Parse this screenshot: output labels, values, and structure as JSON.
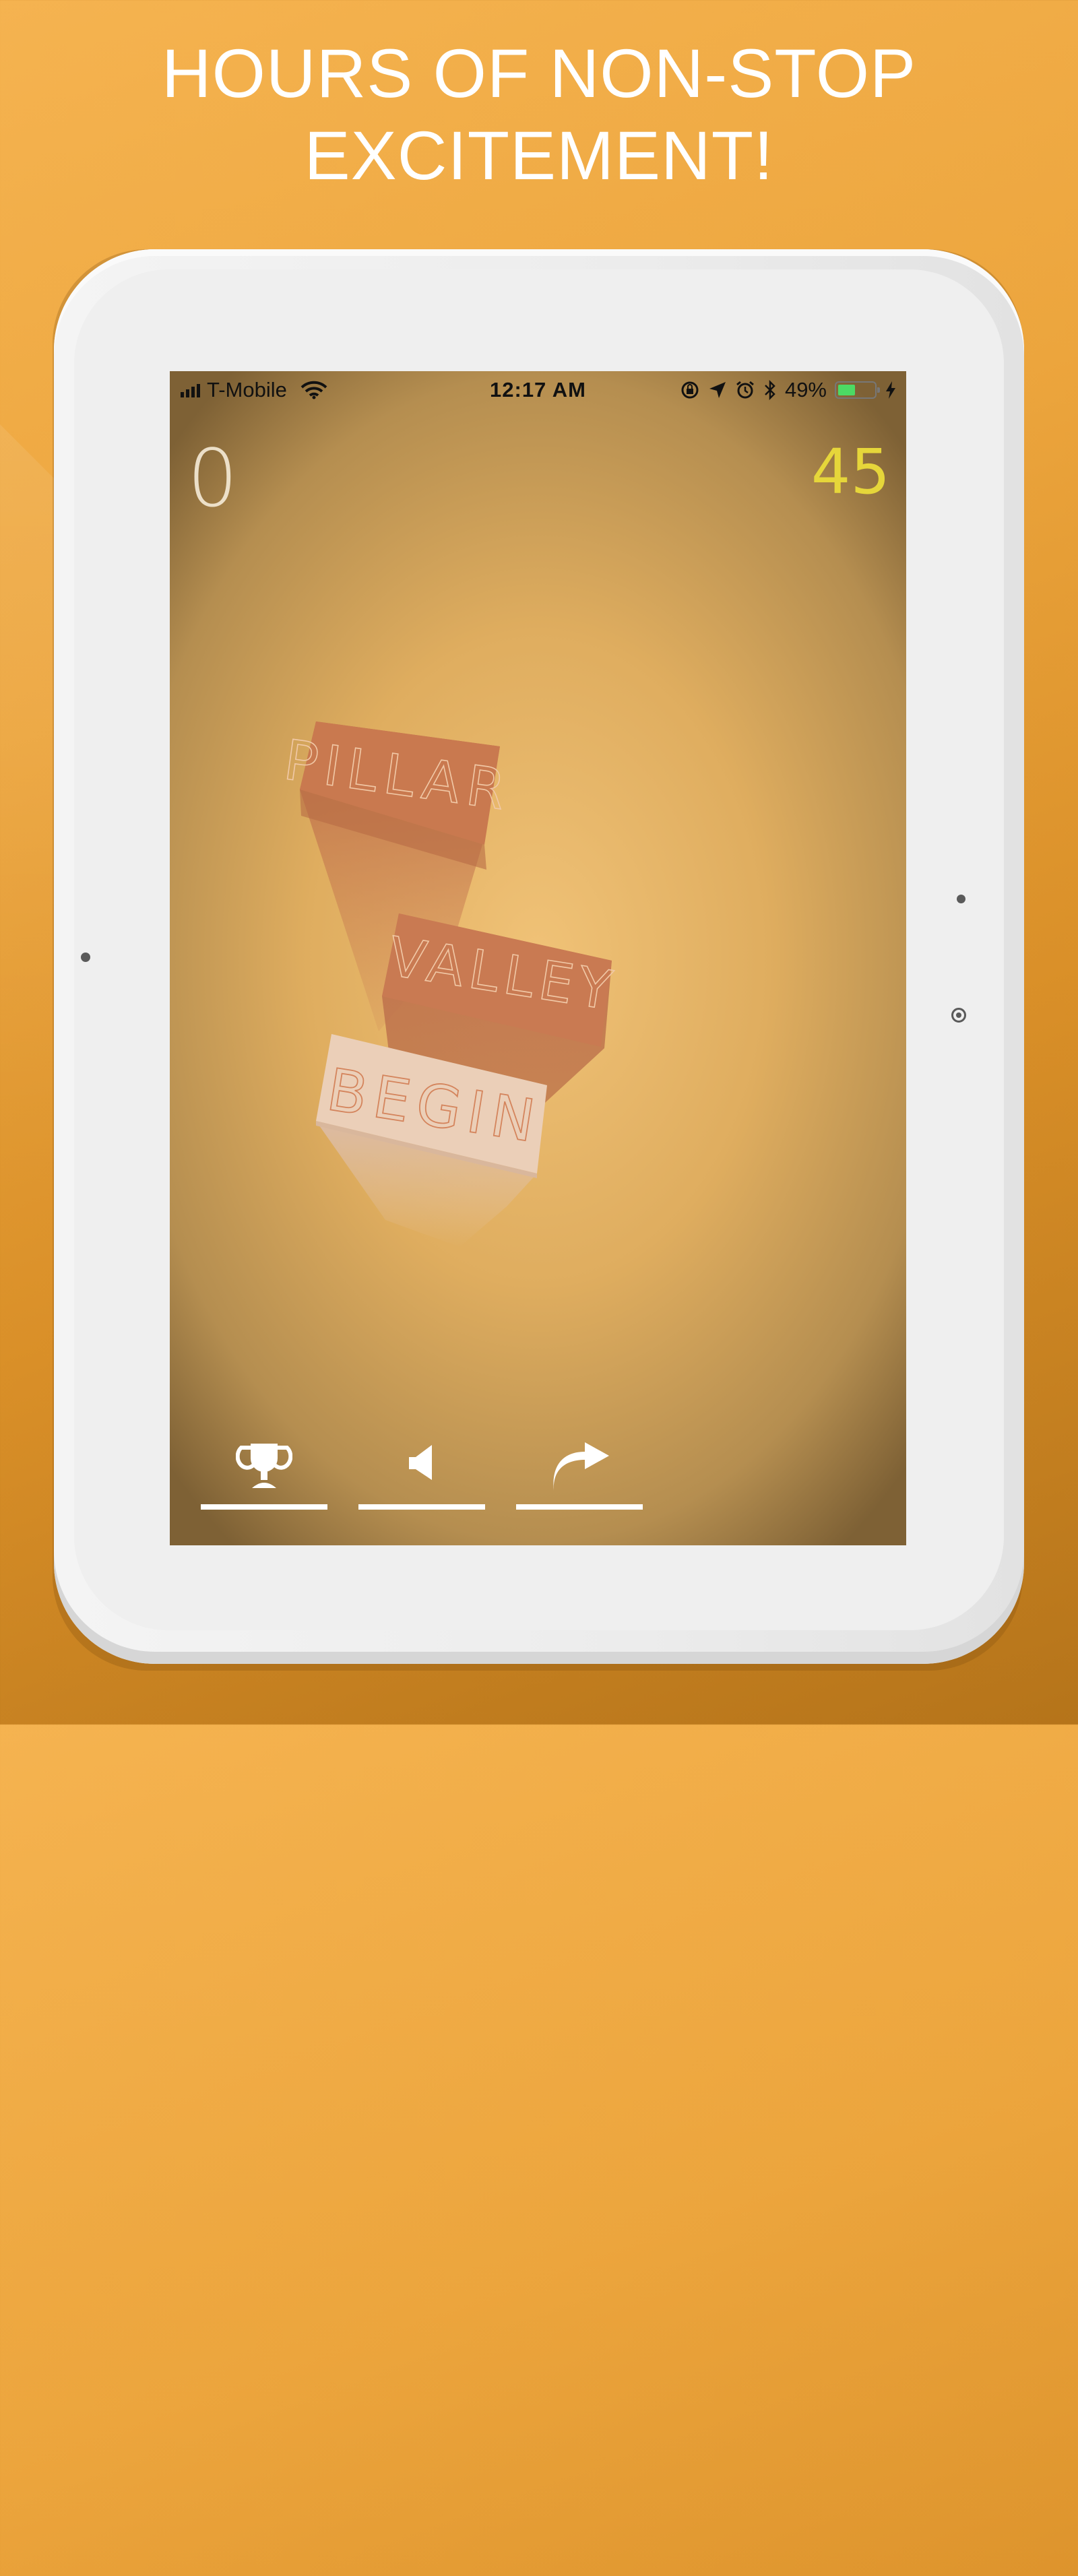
{
  "headline": {
    "line1": "HOURS OF NON-STOP",
    "line2": "EXCITEMENT!"
  },
  "status_bar": {
    "carrier": "T-Mobile",
    "time": "12:17 AM",
    "battery_percent_label": "49%",
    "battery_level": 0.49,
    "icons": [
      "signal-bars-icon",
      "wifi-icon",
      "orientation-lock-icon",
      "location-arrow-icon",
      "alarm-icon",
      "bluetooth-icon",
      "battery-icon",
      "charging-bolt-icon"
    ]
  },
  "game": {
    "score": "0",
    "best_score": "45",
    "blocks": [
      {
        "label": "PILLAR"
      },
      {
        "label": "VALLEY"
      },
      {
        "label": "BEGIN"
      }
    ]
  },
  "toolbar": {
    "buttons": [
      {
        "icon": "trophy-icon"
      },
      {
        "icon": "speaker-icon"
      },
      {
        "icon": "share-arrow-icon"
      }
    ]
  },
  "colors": {
    "background": "#eca53d",
    "score_highlight": "#e6d63a",
    "block_orange": "#c97a52",
    "block_light": "#ebcfb8"
  }
}
